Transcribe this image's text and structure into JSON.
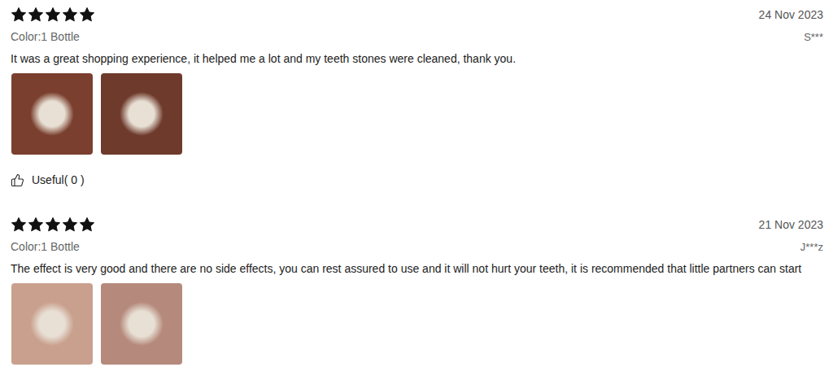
{
  "reviews": [
    {
      "stars": 5,
      "date": "24 Nov 2023",
      "variant": "Color:1 Bottle",
      "user": "S***",
      "text": "It was a great shopping experience, it helped me a lot and my teeth stones were cleaned, thank you.",
      "photos": [
        {
          "color": "#7a3f2e"
        },
        {
          "color": "#6e3a2c"
        }
      ],
      "useful": "Useful( 0 )"
    },
    {
      "stars": 5,
      "date": "21 Nov 2023",
      "variant": "Color:1 Bottle",
      "user": "J***z",
      "text": "The effect is very good and there are no side effects, you can rest assured to use and it will not hurt your teeth, it is recommended that little partners can start",
      "photos": [
        {
          "color": "#c9a08e"
        },
        {
          "color": "#b58a7c"
        }
      ]
    }
  ]
}
